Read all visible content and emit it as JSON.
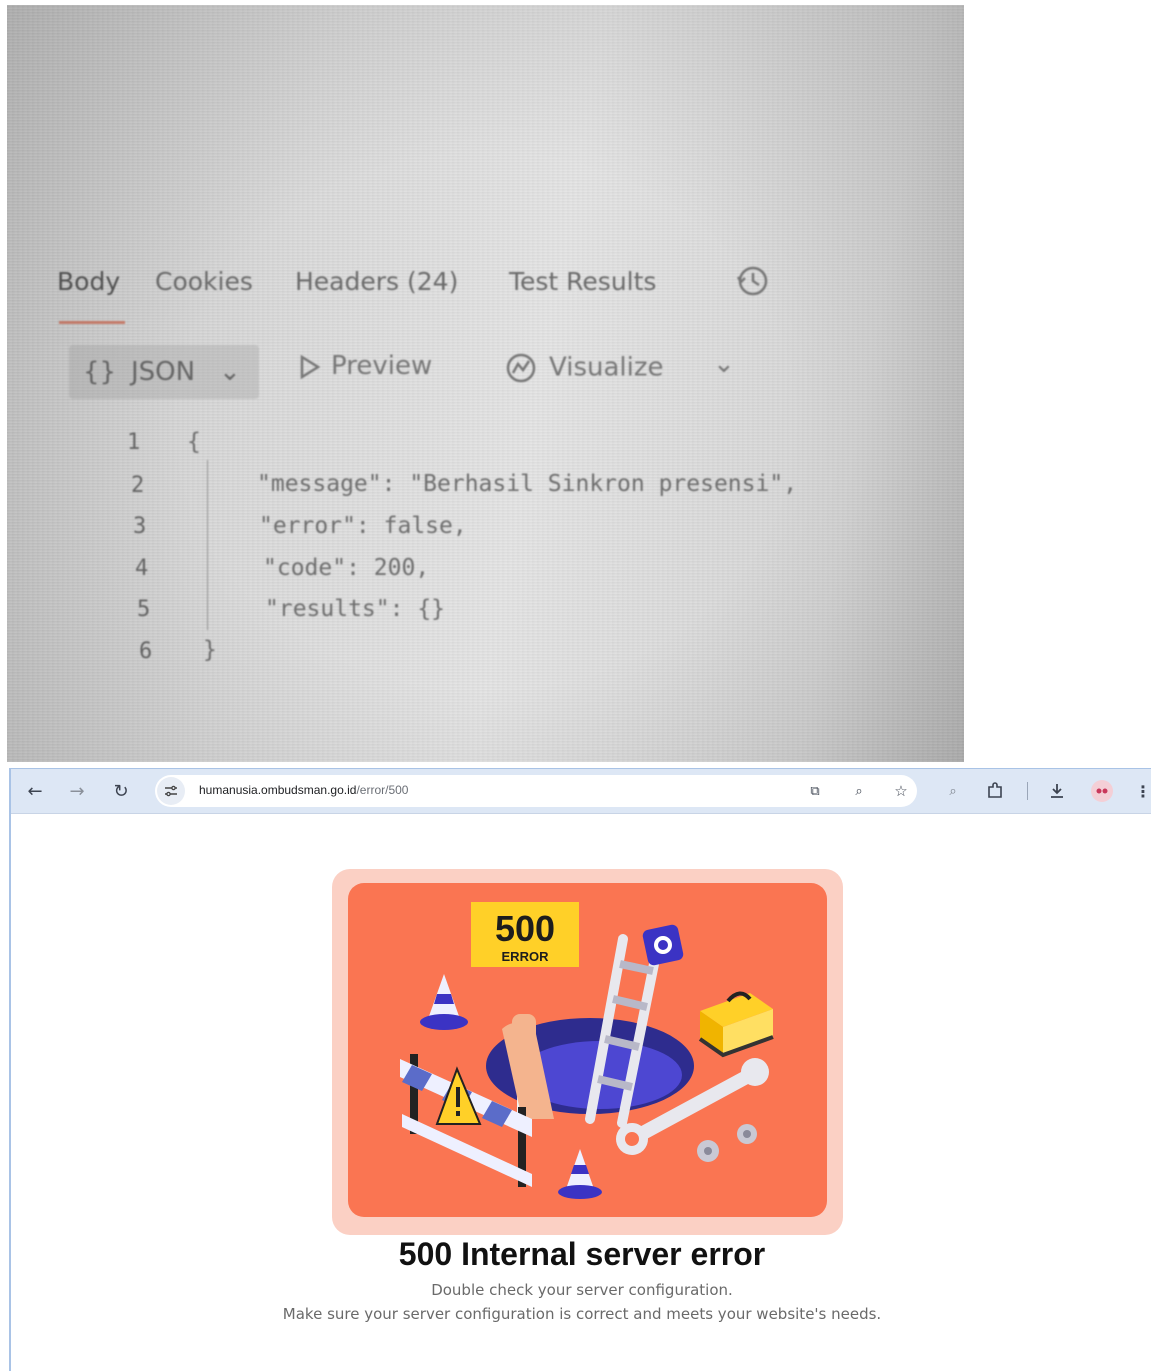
{
  "photo": {
    "tabs": [
      "Body",
      "Cookies",
      "Headers (24)",
      "Test Results"
    ],
    "format_selector": "JSON",
    "preview_label": "Preview",
    "visualize_label": "Visualize",
    "code_lines": [
      {
        "num": "1",
        "text": "{"
      },
      {
        "num": "2",
        "text": "\"message\": \"Berhasil Sinkron presensi\","
      },
      {
        "num": "3",
        "text": "\"error\": false,"
      },
      {
        "num": "4",
        "text": "\"code\": 200,"
      },
      {
        "num": "5",
        "text": "\"results\": {}"
      },
      {
        "num": "6",
        "text": "}"
      }
    ]
  },
  "browser": {
    "url_host": "humanusia.ombudsman.go.id",
    "url_path": "/error/500",
    "illustration": {
      "sign_code": "500",
      "sign_label": "ERROR"
    },
    "error_title": "500 Internal server error",
    "error_line1": "Double check your server configuration.",
    "error_line2": "Make sure your server configuration is correct and meets your website's needs."
  }
}
